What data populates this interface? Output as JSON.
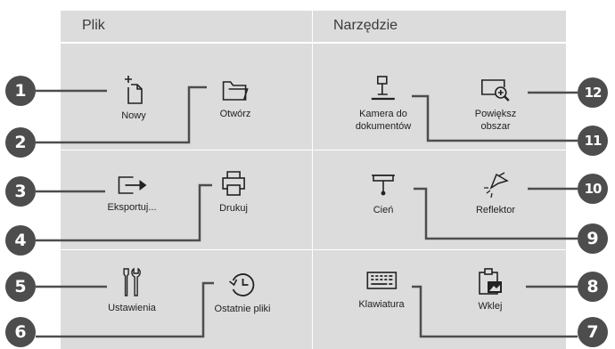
{
  "sections": {
    "file": "Plik",
    "tools": "Narzędzie"
  },
  "items": {
    "new": {
      "label": "Nowy",
      "icon": "new-file-icon"
    },
    "open": {
      "label": "Otwórz",
      "icon": "folder-icon"
    },
    "export": {
      "label": "Eksportuj...",
      "icon": "export-icon"
    },
    "print": {
      "label": "Drukuj",
      "icon": "printer-icon"
    },
    "settings": {
      "label": "Ustawienia",
      "icon": "tools-icon"
    },
    "recent": {
      "label": "Ostatnie pliki",
      "icon": "history-clock-icon"
    },
    "document_camera": {
      "label_line1": "Kamera do",
      "label_line2": "dokumentów",
      "icon": "document-camera-icon"
    },
    "zoom": {
      "label_line1": "Powiększ",
      "label_line2": "obszar",
      "icon": "zoom-area-icon"
    },
    "shade": {
      "label": "Cień",
      "icon": "shade-icon"
    },
    "spotlight": {
      "label": "Reflektor",
      "icon": "spotlight-icon"
    },
    "keyboard": {
      "label": "Klawiatura",
      "icon": "keyboard-icon"
    },
    "paste": {
      "label": "Wklej",
      "icon": "paste-icon"
    }
  },
  "callouts": {
    "c1": "1",
    "c2": "2",
    "c3": "3",
    "c4": "4",
    "c5": "5",
    "c6": "6",
    "c7": "7",
    "c8": "8",
    "c9": "9",
    "c10": "10",
    "c11": "11",
    "c12": "12"
  },
  "colors": {
    "panel": "#dcdcdc",
    "badge": "#4d4d4d",
    "text": "#222222"
  }
}
